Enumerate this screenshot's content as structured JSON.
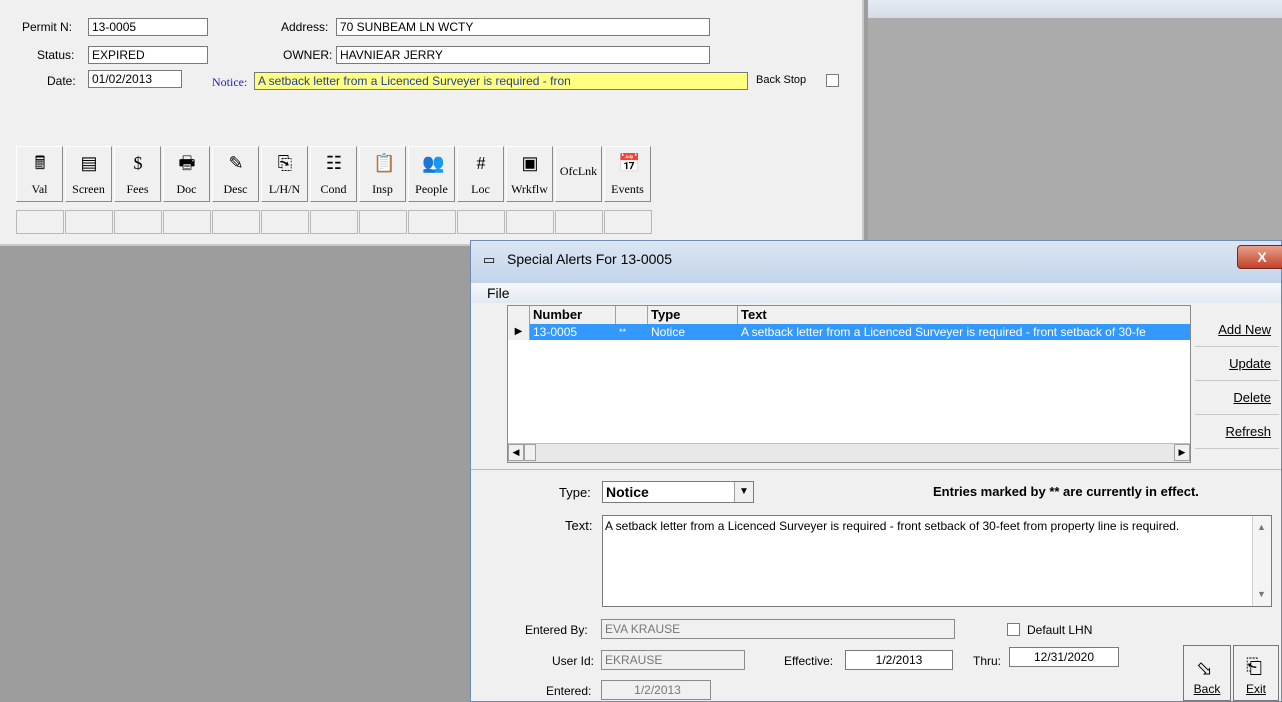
{
  "form": {
    "permit_label": "Permit N:",
    "permit_value": "13-0005",
    "status_label": "Status:",
    "status_value": "EXPIRED",
    "date_label": "Date:",
    "date_value": "01/02/2013",
    "address_label": "Address:",
    "address_value": "70 SUNBEAM LN  WCTY",
    "owner_label": "OWNER:",
    "owner_value": "HAVNIEAR JERRY",
    "notice_label": "Notice:",
    "notice_value": "A setback letter from a Licenced Surveyer is required - fron",
    "backstop_label": "Back Stop"
  },
  "toolbar": [
    {
      "name": "val",
      "label": "Val",
      "icon": "calculator-icon",
      "glyph": "🖩"
    },
    {
      "name": "screen",
      "label": "Screen",
      "icon": "monitor-icon",
      "glyph": "▤"
    },
    {
      "name": "fees",
      "label": "Fees",
      "icon": "dollar-icon",
      "glyph": "$"
    },
    {
      "name": "doc",
      "label": "Doc",
      "icon": "printer-icon",
      "glyph": "🖶"
    },
    {
      "name": "desc",
      "label": "Desc",
      "icon": "pencil-note-icon",
      "glyph": "✎"
    },
    {
      "name": "lhn",
      "label": "L/H/N",
      "icon": "paperclip-icon",
      "glyph": "⎘"
    },
    {
      "name": "cond",
      "label": "Cond",
      "icon": "checklist-icon",
      "glyph": "☷"
    },
    {
      "name": "insp",
      "label": "Insp",
      "icon": "clipboard-icon",
      "glyph": "📋"
    },
    {
      "name": "people",
      "label": "People",
      "icon": "people-icon",
      "glyph": "👥"
    },
    {
      "name": "loc",
      "label": "Loc",
      "icon": "grid-map-icon",
      "glyph": "#"
    },
    {
      "name": "wrkflw",
      "label": "Wrkflw",
      "icon": "workflow-icon",
      "glyph": "▣"
    },
    {
      "name": "ofclnk",
      "label": "OfcLnk",
      "icon": "",
      "glyph": ""
    },
    {
      "name": "events",
      "label": "Events",
      "icon": "calendar-icon",
      "glyph": "📅"
    }
  ],
  "dialog": {
    "title": "Special Alerts For 13-0005",
    "close_glyph": "X",
    "menu_file": "File",
    "columns": [
      "Number",
      "",
      "Type",
      "Text"
    ],
    "row": {
      "number": "13-0005",
      "flag": "**",
      "type": "Notice",
      "text": "A setback letter from a Licenced Surveyer is required - front setback of 30-fe"
    },
    "buttons": {
      "add_new": "Add New",
      "update": "Update",
      "delete": "Delete",
      "refresh": "Refresh"
    },
    "type_label": "Type:",
    "type_value": "Notice",
    "entries_note": "Entries marked by ** are currently in effect.",
    "text_label": "Text:",
    "text_value": "A setback letter from a Licenced Surveyer is required - front setback of 30-feet from property line is required.",
    "entered_by_label": "Entered By:",
    "entered_by_value": "EVA KRAUSE",
    "default_lhn_label": "Default LHN",
    "user_id_label": "User Id:",
    "user_id_value": "EKRAUSE",
    "effective_label": "Effective:",
    "effective_value": "1/2/2013",
    "thru_label": "Thru:",
    "thru_value": "12/31/2020",
    "entered_label": "Entered:",
    "entered_value": "1/2/2013",
    "back_label": "Back",
    "exit_label": "Exit"
  }
}
